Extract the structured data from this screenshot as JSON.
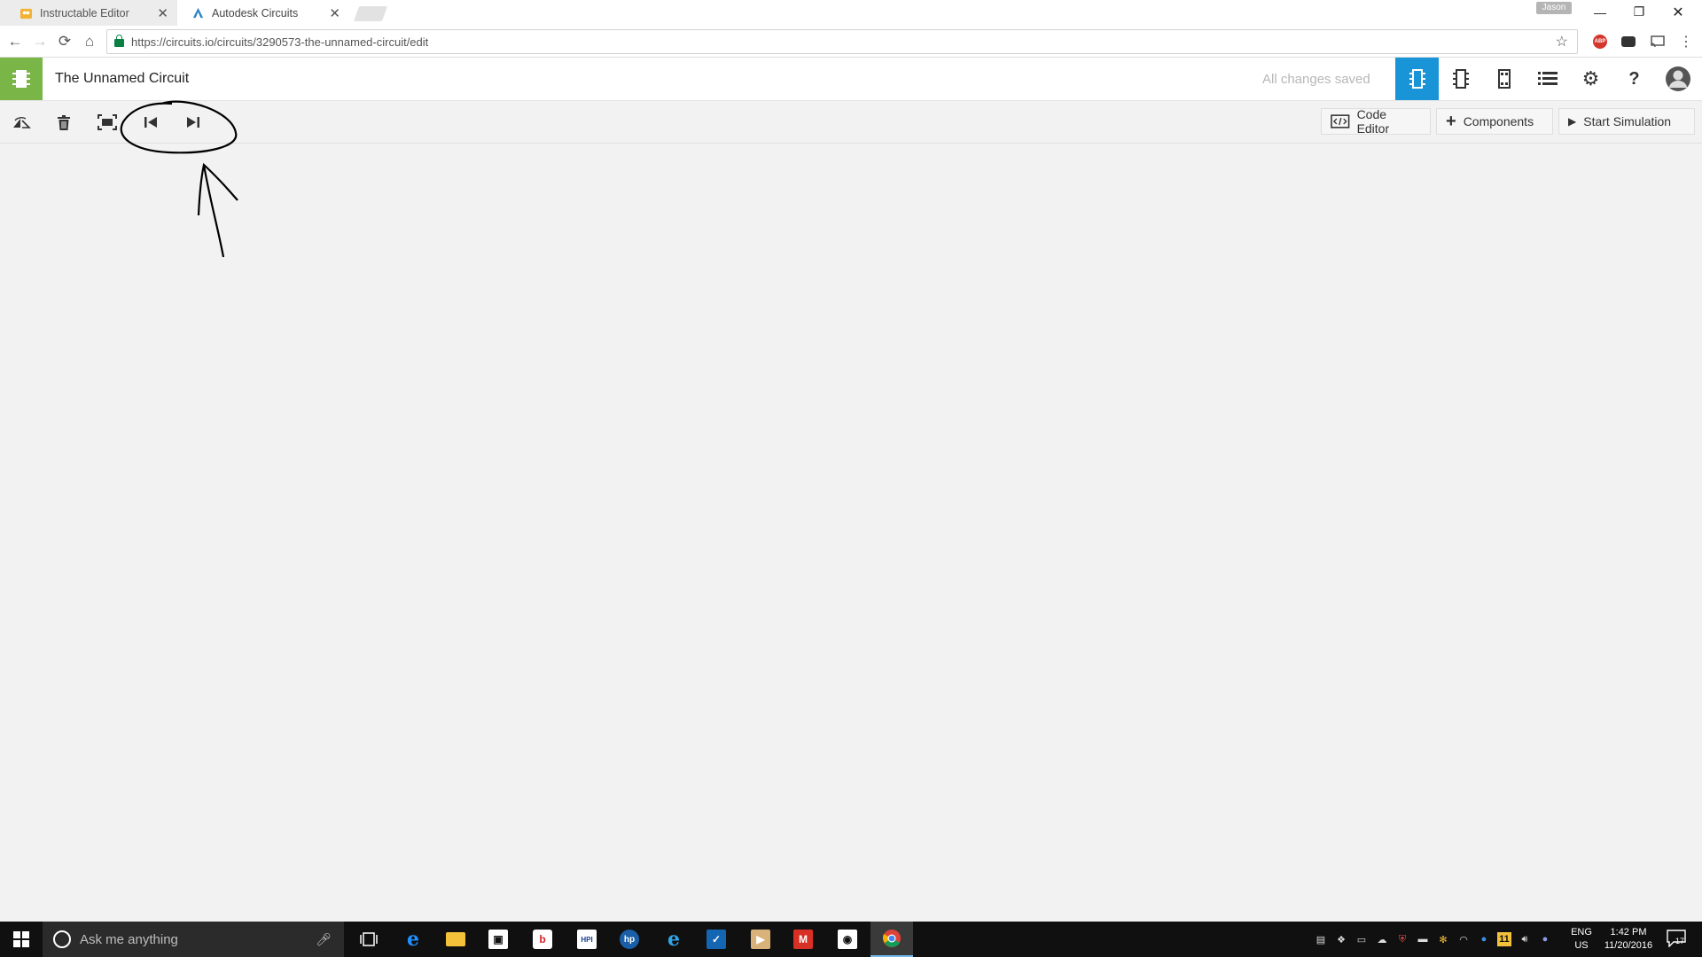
{
  "browser": {
    "tabs": [
      {
        "title": "Instructable Editor",
        "active": false
      },
      {
        "title": "Autodesk Circuits",
        "active": true
      }
    ],
    "user_badge": "Jason",
    "url": "https://circuits.io/circuits/3290573-the-unnamed-circuit/edit"
  },
  "app": {
    "title": "The Unnamed Circuit",
    "save_status": "All changes saved",
    "header_buttons": [
      "breadboard-view-icon",
      "schematic-view-icon",
      "pcb-view-icon",
      "list-icon",
      "gear-icon",
      "help-icon",
      "user-avatar-icon"
    ],
    "accent_color": "#1994d6",
    "logo_color": "#7ab547"
  },
  "toolbar": {
    "left_icons": [
      "rotate-icon",
      "trash-icon",
      "fit-screen-icon",
      "undo-icon",
      "redo-icon"
    ],
    "code_editor_label": "Code Editor",
    "components_label": "Components",
    "start_simulation_label": "Start Simulation"
  },
  "taskbar": {
    "search_placeholder": "Ask me anything",
    "app_icons": [
      "task-view-icon",
      "edge-icon",
      "file-explorer-icon",
      "store-icon",
      "beats-icon",
      "hpi-icon",
      "hp-icon",
      "ie-icon",
      "mail-check-icon",
      "media-icon",
      "gmail-icon",
      "app-icon",
      "chrome-icon"
    ],
    "tray_icons": [
      "tray-icon-1",
      "dropbox-icon",
      "network-icon",
      "onedrive-icon",
      "shield-icon",
      "display-icon",
      "pinwheel-icon",
      "wifi-icon",
      "app-icon",
      "norton-icon",
      "volume-icon",
      "bluetooth-icon"
    ],
    "language": "ENG",
    "region": "US",
    "time": "1:42 PM",
    "date": "11/20/2016",
    "notification_count": "17"
  }
}
